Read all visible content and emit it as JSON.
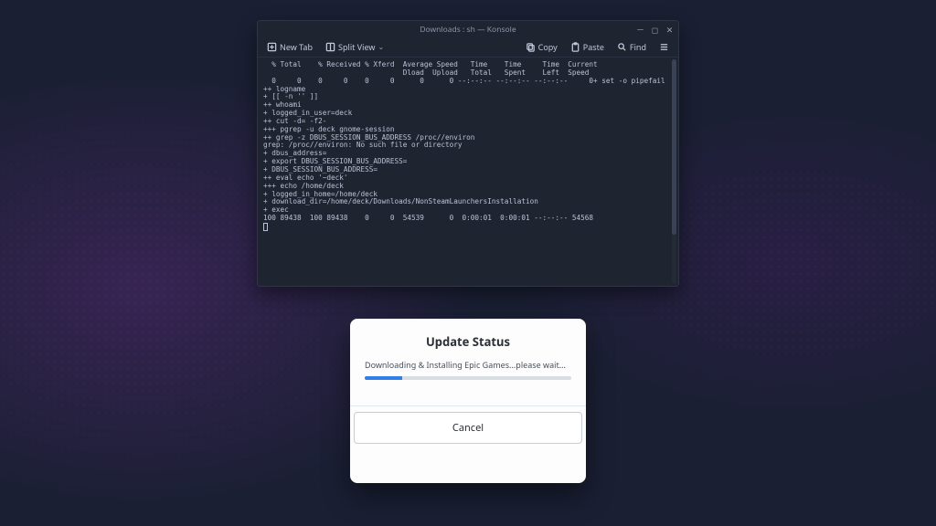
{
  "terminal": {
    "title": "Downloads : sh — Konsole",
    "toolbar": {
      "new_tab": "New Tab",
      "split_view": "Split View",
      "copy": "Copy",
      "paste": "Paste",
      "find": "Find"
    },
    "output": "  % Total    % Received % Xferd  Average Speed   Time    Time     Time  Current\n                                 Dload  Upload   Total   Spent    Left  Speed\n  0     0    0     0    0     0      0      0 --:--:-- --:--:-- --:--:--     0+ set -o pipefail\n++ logname\n+ [[ -n '' ]]\n++ whoami\n+ logged_in_user=deck\n++ cut -d= -f2-\n+++ pgrep -u deck gnome-session\n++ grep -z DBUS_SESSION_BUS_ADDRESS /proc//environ\ngrep: /proc//environ: No such file or directory\n+ dbus_address=\n+ export DBUS_SESSION_BUS_ADDRESS=\n+ DBUS_SESSION_BUS_ADDRESS=\n++ eval echo '~deck'\n+++ echo /home/deck\n+ logged_in_home=/home/deck\n+ download_dir=/home/deck/Downloads/NonSteamLaunchersInstallation\n+ exec\n100 89438  100 89438    0     0  54539      0  0:00:01  0:00:01 --:--:-- 54568"
  },
  "modal": {
    "title": "Update Status",
    "message": "Downloading & Installing Epic Games...please wait...",
    "progress_percent": 18,
    "cancel_label": "Cancel"
  },
  "colors": {
    "accent": "#2f7fe6",
    "terminal_bg": "#1f2431"
  }
}
